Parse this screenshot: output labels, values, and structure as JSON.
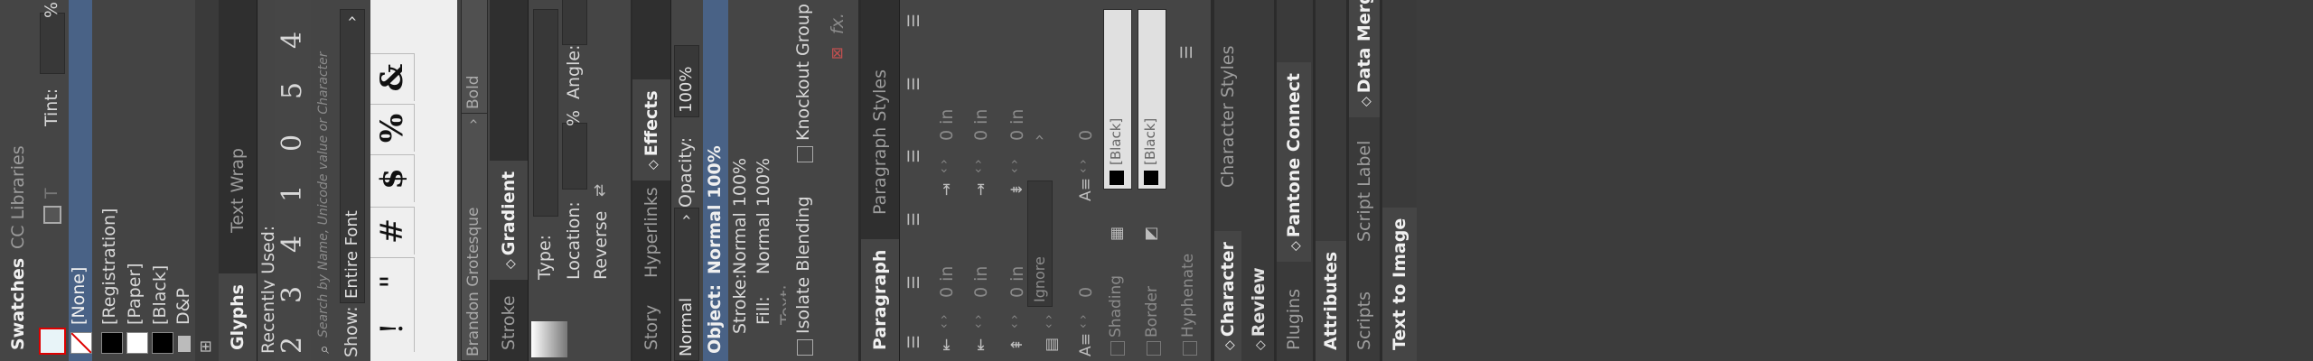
{
  "swatches": {
    "tabs": [
      "Swatches",
      "CC Libraries"
    ],
    "tint_label": "Tint:",
    "tint_unit": "%",
    "items": [
      {
        "name": "[None]",
        "color": "none",
        "selected": true
      },
      {
        "name": "[Registration]",
        "color": "#000000"
      },
      {
        "name": "[Paper]",
        "color": "#ffffff"
      },
      {
        "name": "[Black]",
        "color": "#000000"
      },
      {
        "name": "D&P",
        "color": "folder"
      }
    ]
  },
  "glyphs": {
    "tabs": [
      "Glyphs",
      "Text Wrap"
    ],
    "recently_used_label": "Recently Used:",
    "recent": [
      "2",
      "3",
      "4",
      "1",
      "0",
      "5",
      "4"
    ],
    "search_placeholder": "Search by Name, Unicode value or Character",
    "show_label": "Show:",
    "show_value": "Entire Font",
    "grid": [
      "!",
      "\"",
      "#",
      "$",
      "%",
      "&"
    ],
    "font_name": "Brandon Grotesque",
    "font_style": "Bold"
  },
  "gradient": {
    "tabs": [
      "Stroke",
      "Gradient"
    ],
    "type_label": "Type:",
    "location_label": "Location:",
    "location_unit": "%",
    "angle_label": "Angle:",
    "reverse_label": "Reverse"
  },
  "effects": {
    "tabs": [
      "Story",
      "Hyperlinks",
      "Effects"
    ],
    "mode_value": "Normal",
    "opacity_label": "Opacity:",
    "opacity_value": "100%",
    "rows": [
      {
        "label": "Object:",
        "value": "Normal 100%"
      },
      {
        "label": "Stroke:",
        "value": "Normal 100%"
      },
      {
        "label": "Fill:",
        "value": "Normal 100%"
      },
      {
        "label": "Text:",
        "value": ""
      }
    ],
    "isolate_label": "Isolate Blending",
    "knockout_label": "Knockout Group",
    "fx_label": "fx."
  },
  "paragraph": {
    "tabs": [
      "Paragraph",
      "Paragraph Styles"
    ],
    "indent_values": [
      "0 in",
      "0 in",
      "0 in",
      "0 in",
      "0 in",
      "0 in"
    ],
    "dropcap_values": [
      "0",
      "0"
    ],
    "ignore_value": "Ignore",
    "shading_label": "Shading",
    "border_label": "Border",
    "shading_color": "[Black]",
    "border_color": "[Black]",
    "hyphenate_label": "Hyphenate"
  },
  "right": {
    "top_tabs": [
      "Character",
      "Character Styles"
    ],
    "review_label": "Review",
    "plugins_tabs": [
      "Plugins",
      "Pantone Connect"
    ],
    "attributes_label": "Attributes",
    "scripts_tabs": [
      "Scripts",
      "Script Label",
      "Data Merge"
    ],
    "text_to_image": "Text to Image"
  },
  "colors": {
    "accent": "#496286",
    "panel": "#454545",
    "tabbar": "#2f2f2f"
  }
}
